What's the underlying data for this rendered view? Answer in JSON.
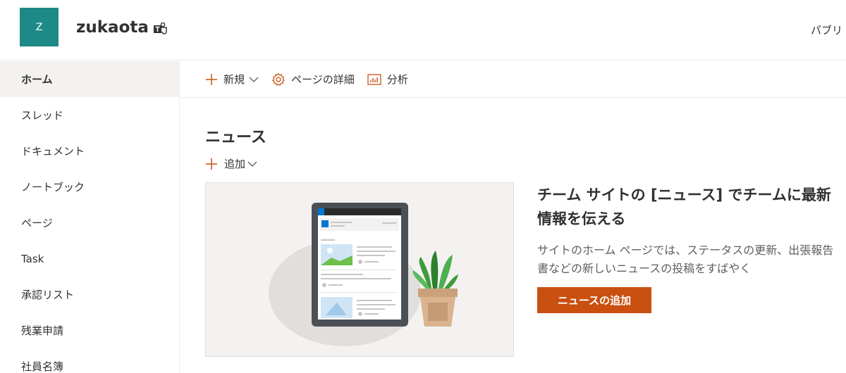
{
  "header": {
    "logo_letter": "Z",
    "site_title": "zukaota",
    "right_text": "パブリ"
  },
  "left_nav": {
    "items": [
      {
        "label": "ホーム",
        "active": true
      },
      {
        "label": "スレッド"
      },
      {
        "label": "ドキュメント"
      },
      {
        "label": "ノートブック"
      },
      {
        "label": "ページ"
      },
      {
        "label": "Task"
      },
      {
        "label": "承認リスト"
      },
      {
        "label": "残業申請"
      },
      {
        "label": "社員名簿"
      }
    ]
  },
  "command_bar": {
    "new_label": "新規",
    "page_details_label": "ページの詳細",
    "analytics_label": "分析"
  },
  "news": {
    "title": "ニュース",
    "add_label": "追加",
    "promo_title": "チーム サイトの [ニュース] でチームに最新情報を伝える",
    "promo_description": "サイトのホーム ページでは、ステータスの更新、出張報告書などの新しいニュースの投稿をすばやく",
    "add_news_button": "ニュースの追加"
  },
  "colors": {
    "brand_teal": "#1e8a87",
    "accent_orange": "#ca5010"
  }
}
